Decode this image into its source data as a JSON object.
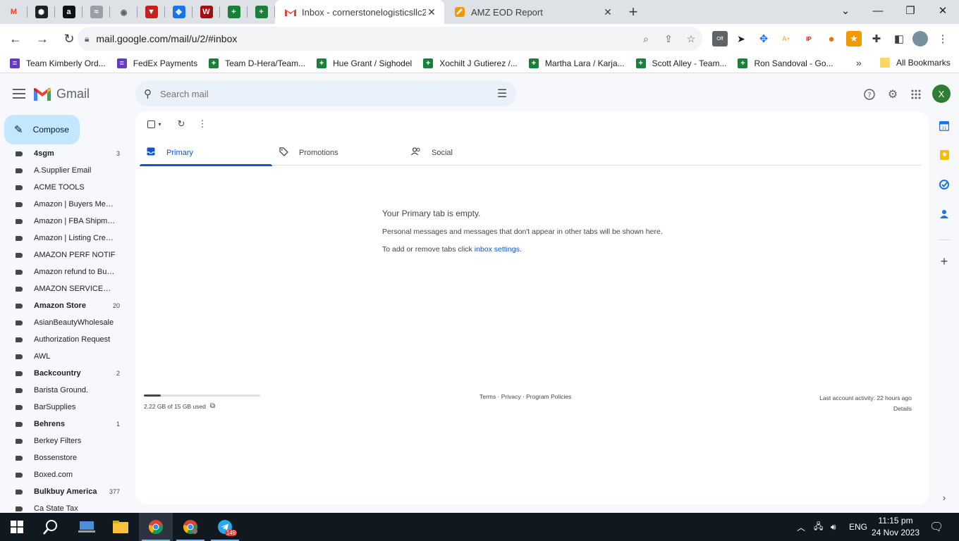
{
  "browser": {
    "pinned_tabs": [
      {
        "name": "gmail-pinned",
        "glyph": "M",
        "color": "#ea4335"
      },
      {
        "name": "chatgpt-pinned",
        "glyph": "✺",
        "color": "#202124"
      },
      {
        "name": "amazon-pinned",
        "glyph": "a",
        "color": "#111111"
      },
      {
        "name": "pinned-4",
        "glyph": "≈",
        "color": "#9aa0a6"
      },
      {
        "name": "globe-pinned",
        "glyph": "◉",
        "color": "#5f6368"
      },
      {
        "name": "pinned-6",
        "glyph": "▼",
        "color": "#c5221f"
      },
      {
        "name": "pinned-7",
        "glyph": "✥",
        "color": "#1a73e8"
      },
      {
        "name": "pinned-8",
        "glyph": "W",
        "color": "#a50e0e"
      },
      {
        "name": "sheets-pinned",
        "glyph": "+",
        "color": "#188038"
      },
      {
        "name": "sheets-pinned-2",
        "glyph": "+",
        "color": "#188038"
      }
    ],
    "active_tab": {
      "title": "Inbox - cornerstonelogisticsllc20"
    },
    "inactive_tab": {
      "title": "AMZ EOD Report"
    },
    "url": "mail.google.com/mail/u/2/#inbox"
  },
  "bookmarks": [
    {
      "label": "Team Kimberly Ord...",
      "color": "#673ab7",
      "glyph": "≡"
    },
    {
      "label": "FedEx Payments",
      "color": "#673ab7",
      "glyph": "≡"
    },
    {
      "label": "Team D-Hera/Team...",
      "color": "#188038",
      "glyph": "+"
    },
    {
      "label": "Hue Grant / Sighodel",
      "color": "#188038",
      "glyph": "+"
    },
    {
      "label": "Xochilt J Gutierez /...",
      "color": "#188038",
      "glyph": "+"
    },
    {
      "label": "Martha Lara / Karja...",
      "color": "#188038",
      "glyph": "+"
    },
    {
      "label": "Scott Alley - Team...",
      "color": "#188038",
      "glyph": "+"
    },
    {
      "label": "Ron Sandoval - Go...",
      "color": "#188038",
      "glyph": "+"
    }
  ],
  "all_bookmarks": "All Bookmarks",
  "gmail": {
    "product": "Gmail",
    "search_placeholder": "Search mail",
    "avatar_letter": "X",
    "compose": "Compose"
  },
  "labels": [
    {
      "name": "4sgm",
      "count": "3",
      "bold": true
    },
    {
      "name": "A.Supplier Email",
      "count": "",
      "bold": false
    },
    {
      "name": "ACME TOOLS",
      "count": "",
      "bold": false
    },
    {
      "name": "Amazon | Buyers Messa...",
      "count": "",
      "bold": false
    },
    {
      "name": "Amazon | FBA Shipments",
      "count": "",
      "bold": false
    },
    {
      "name": "Amazon | Listing Created",
      "count": "",
      "bold": false
    },
    {
      "name": "AMAZON PERF NOTIF",
      "count": "",
      "bold": false
    },
    {
      "name": "Amazon refund to Buyers",
      "count": "",
      "bold": false
    },
    {
      "name": "AMAZON SERVICES/PAY...",
      "count": "",
      "bold": false
    },
    {
      "name": "Amazon Store",
      "count": "20",
      "bold": true
    },
    {
      "name": "AsianBeautyWholesale",
      "count": "",
      "bold": false
    },
    {
      "name": "Authorization Request",
      "count": "",
      "bold": false
    },
    {
      "name": "AWL",
      "count": "",
      "bold": false
    },
    {
      "name": "Backcountry",
      "count": "2",
      "bold": true
    },
    {
      "name": "Barista Ground.",
      "count": "",
      "bold": false
    },
    {
      "name": "BarSupplies",
      "count": "",
      "bold": false
    },
    {
      "name": "Behrens",
      "count": "1",
      "bold": true
    },
    {
      "name": "Berkey Filters",
      "count": "",
      "bold": false
    },
    {
      "name": "Bossenstore",
      "count": "",
      "bold": false
    },
    {
      "name": "Boxed.com",
      "count": "",
      "bold": false
    },
    {
      "name": "Bulkbuy America",
      "count": "377",
      "bold": true
    },
    {
      "name": "Ca State Tax",
      "count": "",
      "bold": false
    }
  ],
  "inbox_tabs": [
    {
      "label": "Primary",
      "icon": "inbox-icon",
      "active": true
    },
    {
      "label": "Promotions",
      "icon": "tag-icon",
      "active": false
    },
    {
      "label": "Social",
      "icon": "people-icon",
      "active": false
    }
  ],
  "empty_state": {
    "heading": "Your Primary tab is empty.",
    "line1": "Personal messages and messages that don't appear in other tabs will be shown here.",
    "line2_prefix": "To add or remove tabs click ",
    "line2_link": "inbox settings",
    "line2_suffix": "."
  },
  "storage": {
    "text": "2.22 GB of 15 GB used",
    "fraction": 0.148
  },
  "footer": {
    "terms": "Terms",
    "privacy": "Privacy",
    "policies": "Program Policies",
    "sep": " · ",
    "activity": "Last account activity: 22 hours ago",
    "details": "Details"
  },
  "taskbar": {
    "lang": "ENG",
    "time": "11:15 pm",
    "date": "24 Nov 2023",
    "telegram_badge": "149"
  }
}
